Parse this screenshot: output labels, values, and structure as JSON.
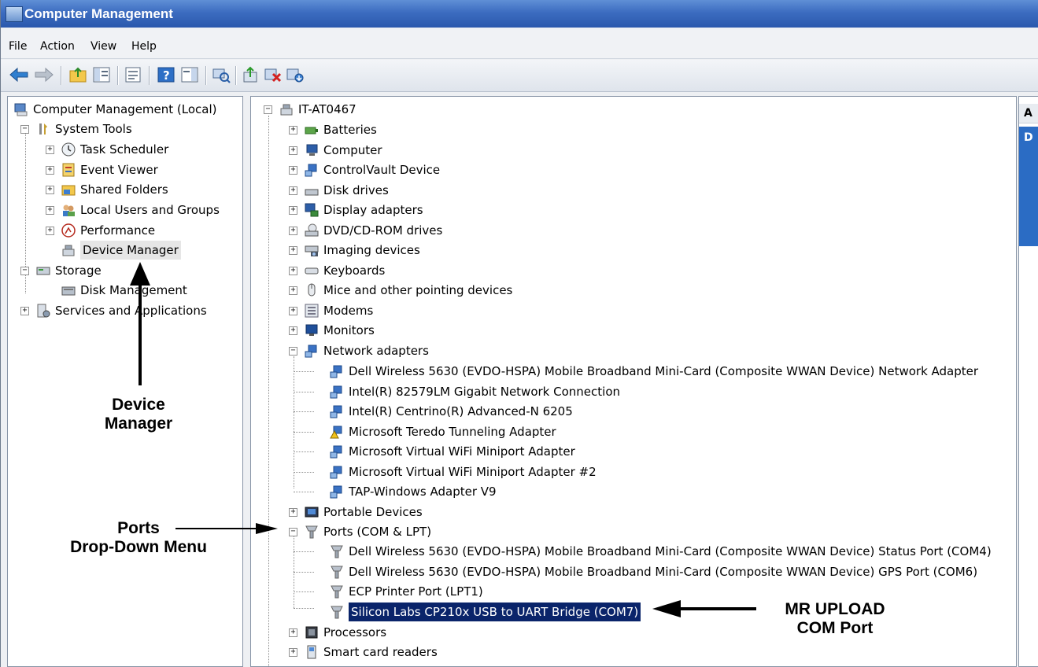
{
  "window": {
    "title": "Computer Management"
  },
  "menu": [
    "File",
    "Action",
    "View",
    "Help"
  ],
  "toolbar_icons": [
    "back-icon",
    "forward-icon",
    "up-folder-icon",
    "show-hide-tree-icon",
    "properties-icon",
    "help-icon",
    "show-hide-action-icon",
    "scan-hardware-icon",
    "update-driver-icon",
    "uninstall-icon",
    "enable-device-icon"
  ],
  "left_tree": {
    "root": "Computer Management (Local)",
    "system_tools": "System Tools",
    "task_scheduler": "Task Scheduler",
    "event_viewer": "Event Viewer",
    "shared_folders": "Shared Folders",
    "local_users": "Local Users and Groups",
    "performance": "Performance",
    "device_manager": "Device Manager",
    "storage": "Storage",
    "disk_management": "Disk Management",
    "services": "Services and Applications"
  },
  "device_tree": {
    "root": "IT-AT0467",
    "categories": {
      "batteries": "Batteries",
      "computer": "Computer",
      "controlvault": "ControlVault Device",
      "disk_drives": "Disk drives",
      "display": "Display adapters",
      "dvd": "DVD/CD-ROM drives",
      "imaging": "Imaging devices",
      "keyboards": "Keyboards",
      "mice": "Mice and other pointing devices",
      "modems": "Modems",
      "monitors": "Monitors",
      "network": "Network adapters",
      "portable": "Portable Devices",
      "ports": "Ports (COM & LPT)",
      "processors": "Processors",
      "smartcard": "Smart card readers"
    },
    "network_children": [
      "Dell Wireless 5630 (EVDO-HSPA) Mobile Broadband Mini-Card (Composite WWAN Device) Network Adapter",
      "Intel(R) 82579LM Gigabit Network Connection",
      "Intel(R) Centrino(R) Advanced-N 6205",
      "Microsoft Teredo Tunneling Adapter",
      "Microsoft Virtual WiFi Miniport Adapter",
      "Microsoft Virtual WiFi Miniport Adapter #2",
      "TAP-Windows Adapter V9"
    ],
    "ports_children": [
      "Dell Wireless 5630 (EVDO-HSPA) Mobile Broadband Mini-Card (Composite WWAN Device) Status Port (COM4)",
      "Dell Wireless 5630 (EVDO-HSPA) Mobile Broadband Mini-Card (Composite WWAN Device) GPS Port (COM6)",
      "ECP Printer Port (LPT1)",
      "Silicon Labs CP210x USB to UART Bridge (COM7)"
    ]
  },
  "right_pane": {
    "header": "A",
    "selected": "D"
  },
  "annotations": {
    "device_manager_line1": "Device",
    "device_manager_line2": "Manager",
    "ports_line1": "Ports",
    "ports_line2": "Drop-Down Menu",
    "mr_line1": "MR UPLOAD",
    "mr_line2": "COM Port"
  },
  "colors": {
    "titlebar": "#3c6cc0",
    "selection": "#0a246a",
    "action_pane_accent": "#2b6cc4"
  }
}
